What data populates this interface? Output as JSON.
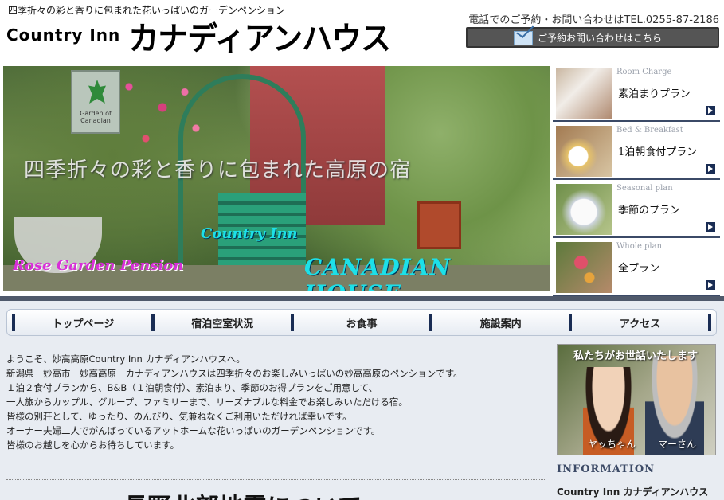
{
  "header": {
    "tagline": "四季折々の彩と香りに包まれた花いっぱいのガーデンペンション",
    "logo_en": "Country Inn",
    "logo_jp": "カナディアンハウス",
    "tel": "電話でのご予約・お問い合わせはTEL.0255-87-2186",
    "contact_button": "ご予約お問い合わせはこちら"
  },
  "hero": {
    "caption": "四季折々の彩と香りに包まれた高原の宿",
    "country_inn": "Country Inn",
    "rose_garden": "Rose Garden Pension",
    "canadian_house": "CANADIAN HOUSE",
    "sign": "Garden of Canadian"
  },
  "plans": [
    {
      "en": "Room Charge",
      "jp": "素泊まりプラン"
    },
    {
      "en": "Bed & Breakfast",
      "jp": "1泊朝食付プラン"
    },
    {
      "en": "Seasonal plan",
      "jp": "季節のプラン"
    },
    {
      "en": "Whole plan",
      "jp": "全プラン"
    }
  ],
  "nav": [
    "トップページ",
    "宿泊空室状況",
    "お食事",
    "施設案内",
    "アクセス"
  ],
  "intro": [
    "ようこそ、妙高高原Country Inn カナディアンハウスへ。",
    "新潟県　妙高市　妙高高原　カナディアンハウスは四季折々のお楽しみいっぱいの妙高高原のペンションです。",
    "１泊２食付プランから、B&B（１泊朝食付）、素泊まり、季節のお得プランをご用意して、",
    "一人旅からカップル、グループ、ファミリーまで、リーズナブルな料金でお楽しみいただける宿。",
    "皆様の別荘として、ゆったり、のんびり、気兼ねなくご利用いただければ幸いです。",
    "オーナー夫婦二人でがんばっているアットホームな花いっぱいのガーデンペンションです。",
    "皆様のお越しを心からお待ちしています。"
  ],
  "main": {
    "heading": "長野北部地震について"
  },
  "staff": {
    "title": "私たちがお世話いたします",
    "name1": "ヤッちゃん",
    "name2": "マーさん"
  },
  "info": {
    "heading": "INFORMATION",
    "body": "Country Inn カナディアンハウス"
  }
}
